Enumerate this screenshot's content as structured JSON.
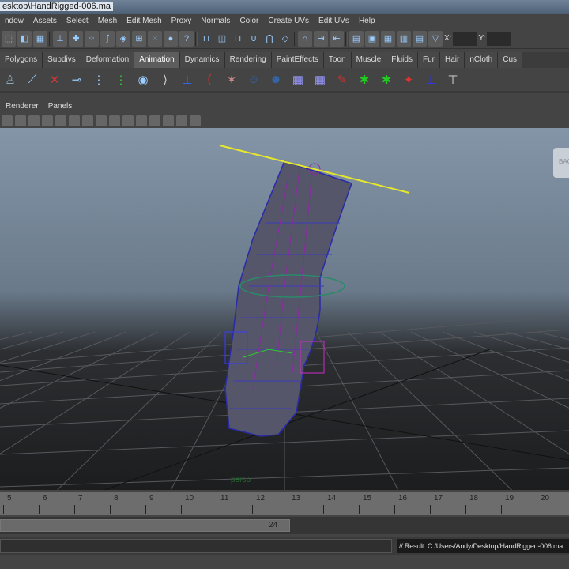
{
  "window": {
    "title": "esktop\\HandRigged-006.ma"
  },
  "menu": [
    "ndow",
    "Assets",
    "Select",
    "Mesh",
    "Edit Mesh",
    "Proxy",
    "Normals",
    "Color",
    "Create UVs",
    "Edit UVs",
    "Help"
  ],
  "toolbar": {
    "x_label": "X:",
    "y_label": "Y:",
    "icons": [
      "select-by-hierarchy-icon",
      "select-by-object-icon",
      "select-by-component-icon",
      "pick-mask-icon",
      "point-mask-icon",
      "edge-mask-icon",
      "curve-mask-icon",
      "surface-mask-icon",
      "deform-mask-icon",
      "dynamics-mask-icon",
      "render-mask-icon",
      "misc-mask-icon",
      "lock-icon",
      "highlight-selection-icon",
      "snap-grid-icon",
      "snap-curve-icon",
      "snap-point-icon",
      "snap-view-plane-icon",
      "make-live-icon",
      "input-ops-icon",
      "output-ops-icon",
      "construction-history-icon",
      "render-view-icon",
      "render-frame-icon",
      "ipr-render-icon",
      "render-settings-icon",
      "transform-input-icon"
    ]
  },
  "shelf_tabs": [
    "Polygons",
    "Subdivs",
    "Deformation",
    "Animation",
    "Dynamics",
    "Rendering",
    "PaintEffects",
    "Toon",
    "Muscle",
    "Fluids",
    "Fur",
    "Hair",
    "nCloth",
    "Cus"
  ],
  "active_tab": "Animation",
  "shelf_icons": [
    "skeleton-icon",
    "joint-tool-icon",
    "ik-handle-icon",
    "ik-spline-icon",
    "insert-joint-icon",
    "connect-joint-icon",
    "remove-joint-icon",
    "mirror-joint-icon",
    "orient-joint-icon",
    "ik-spline-handle-icon",
    "full-body-ik-icon",
    "bind-skin-icon",
    "smooth-bind-icon",
    "paint-weights-icon",
    "copy-weights-icon",
    "paint-skin-weights-icon",
    "cluster-icon",
    "lattice-icon",
    "soft-modification-icon",
    "blend-shape-icon",
    "wire-tool-icon"
  ],
  "panel_menu": [
    "Renderer",
    "Panels"
  ],
  "viewport": {
    "camera_label": "persp",
    "viewcube_label": "BAC"
  },
  "timeline": {
    "ticks": [
      5,
      6,
      7,
      8,
      9,
      10,
      11,
      12,
      13,
      14,
      15,
      16,
      17,
      18,
      19,
      20
    ]
  },
  "range": {
    "end": "24"
  },
  "command": {
    "result": "// Result: C:/Users/Andy/Desktop/HandRigged-006.ma"
  }
}
